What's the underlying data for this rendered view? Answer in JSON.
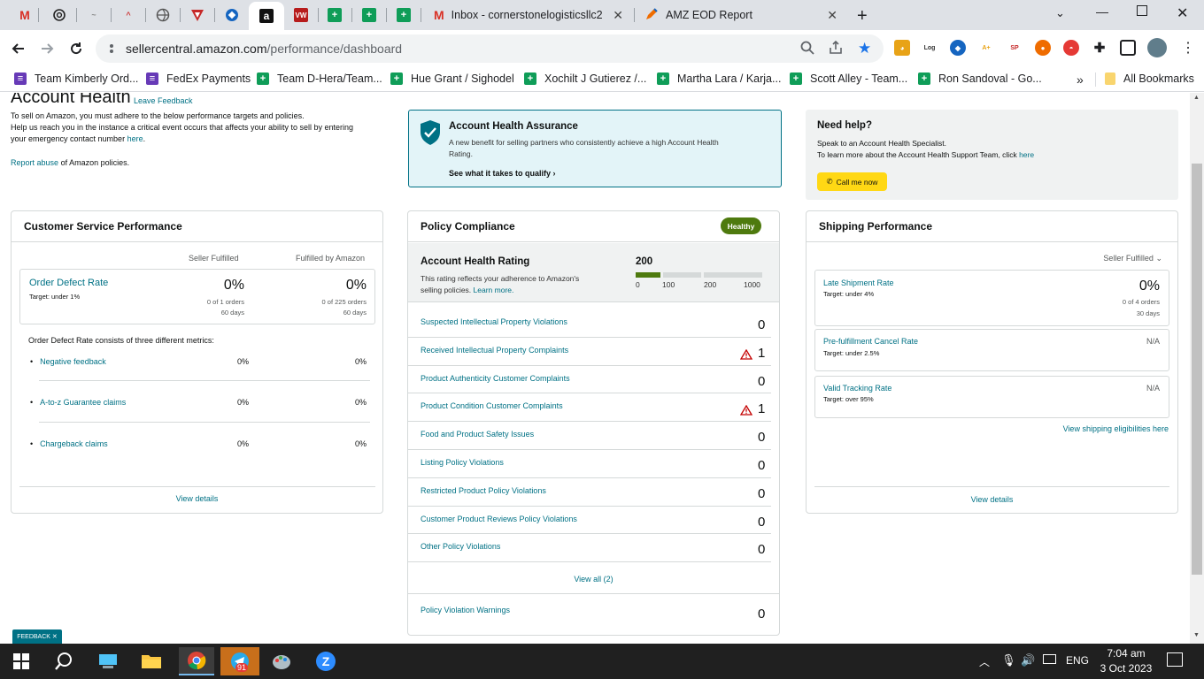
{
  "browser": {
    "tabs": [
      {
        "icon": "gmail-icon"
      },
      {
        "icon": "openai-icon"
      },
      {
        "icon": "doc-icon"
      },
      {
        "icon": "doc-icon"
      },
      {
        "icon": "globe-icon"
      },
      {
        "icon": "v-icon"
      },
      {
        "icon": "grid-icon"
      },
      {
        "icon": "amazon-icon"
      },
      {
        "icon": "vw-icon"
      },
      {
        "icon": "sheets-icon"
      },
      {
        "icon": "sheets-icon"
      },
      {
        "icon": "sheets-icon"
      }
    ],
    "wide_tabs": [
      {
        "title": "Inbox - cornerstonelogisticsllc20",
        "icon": "gmail-icon"
      },
      {
        "title": "AMZ EOD Report",
        "icon": "pencil-icon"
      }
    ],
    "new_tab": "+",
    "url_host": "sellercentral.amazon.com",
    "url_path": "/performance/dashboard",
    "bookmarks": [
      {
        "label": "Team Kimberly Ord...",
        "type": "form"
      },
      {
        "label": "FedEx Payments",
        "type": "form"
      },
      {
        "label": "Team D-Hera/Team...",
        "type": "sheet"
      },
      {
        "label": "Hue Grant / Sighodel",
        "type": "sheet"
      },
      {
        "label": "Xochilt J Gutierez /...",
        "type": "sheet"
      },
      {
        "label": "Martha Lara / Karja...",
        "type": "sheet"
      },
      {
        "label": "Scott Alley - Team...",
        "type": "sheet"
      },
      {
        "label": "Ron Sandoval - Go...",
        "type": "sheet"
      }
    ],
    "more_bookmarks": "»",
    "all_bookmarks": "All Bookmarks"
  },
  "page": {
    "title": "Account Health",
    "leave_feedback": "Leave Feedback",
    "intro1": "To sell on Amazon, you must adhere to the below performance targets and policies.",
    "intro2": "Help us reach you in the instance a critical event occurs that affects your ability to sell by entering",
    "intro3_pre": "your emergency contact number",
    "intro3_link": "here",
    "intro3_post": ".",
    "report_link": "Report abuse",
    "report_post": "of Amazon policies.",
    "aha": {
      "title": "Account Health Assurance",
      "desc1": "A new benefit for selling partners who consistently achieve a high Account Health",
      "desc2": "Rating.",
      "link": "See what it takes to qualify"
    },
    "help": {
      "title": "Need help?",
      "line1": "Speak to an Account Health Specialist.",
      "line2_pre": "To learn more about the Account Health Support Team, click",
      "line2_link": "here",
      "button": "Call me now"
    },
    "csp": {
      "title": "Customer Service Performance",
      "col1": "Seller Fulfilled",
      "col2": "Fulfilled by Amazon",
      "odr_label": "Order Defect Rate",
      "odr_target": "Target: under 1%",
      "odr_sf_value": "0%",
      "odr_sf_orders": "0 of 1 orders",
      "odr_sf_days": "60 days",
      "odr_fba_value": "0%",
      "odr_fba_orders": "0 of 225 orders",
      "odr_fba_days": "60 days",
      "consists": "Order Defect Rate consists of three different metrics:",
      "metrics": [
        {
          "label": "Negative feedback",
          "sf": "0%",
          "fba": "0%"
        },
        {
          "label": "A-to-z Guarantee claims",
          "sf": "0%",
          "fba": "0%"
        },
        {
          "label": "Chargeback claims",
          "sf": "0%",
          "fba": "0%"
        }
      ],
      "view_details": "View details"
    },
    "policy": {
      "title": "Policy Compliance",
      "badge": "Healthy",
      "ahr_title": "Account Health Rating",
      "ahr_desc1": "This rating reflects your adherence to Amazon's",
      "ahr_desc2_pre": "selling policies.",
      "ahr_desc2_link": "Learn more.",
      "ahr_value": "200",
      "ahr_fill": 0.2,
      "scale": [
        "0",
        "100",
        "200",
        "1000"
      ],
      "items": [
        {
          "label": "Suspected Intellectual Property Violations",
          "count": "0",
          "warn": false
        },
        {
          "label": "Received Intellectual Property Complaints",
          "count": "1",
          "warn": true
        },
        {
          "label": "Product Authenticity Customer Complaints",
          "count": "0",
          "warn": false
        },
        {
          "label": "Product Condition Customer Complaints",
          "count": "1",
          "warn": true
        },
        {
          "label": "Food and Product Safety Issues",
          "count": "0",
          "warn": false
        },
        {
          "label": "Listing Policy Violations",
          "count": "0",
          "warn": false
        },
        {
          "label": "Restricted Product Policy Violations",
          "count": "0",
          "warn": false
        },
        {
          "label": "Customer Product Reviews Policy Violations",
          "count": "0",
          "warn": false
        },
        {
          "label": "Other Policy Violations",
          "count": "0",
          "warn": false
        }
      ],
      "view_all": "View all (2)",
      "warnings_label": "Policy Violation Warnings",
      "warnings_count": "0"
    },
    "shipping": {
      "title": "Shipping Performance",
      "filter": "Seller Fulfilled",
      "late_label": "Late Shipment Rate",
      "late_target": "Target: under 4%",
      "late_value": "0%",
      "late_orders": "0 of 4 orders",
      "late_days": "30 days",
      "cancel_label": "Pre-fulfillment Cancel Rate",
      "cancel_target": "Target: under 2.5%",
      "cancel_value": "N/A",
      "vtr_label": "Valid Tracking Rate",
      "vtr_target": "Target: over 95%",
      "vtr_value": "N/A",
      "eligibility": "View shipping eligibilities here",
      "view_details": "View details"
    },
    "feedback_tab": "FEEDBACK"
  },
  "taskbar": {
    "time": "7:04 am",
    "date": "3 Oct 2023",
    "lang": "ENG",
    "badge": "91"
  },
  "colors": {
    "accent": "#007185",
    "healthy": "#4e7a0e",
    "call_btn": "#ffd814"
  }
}
